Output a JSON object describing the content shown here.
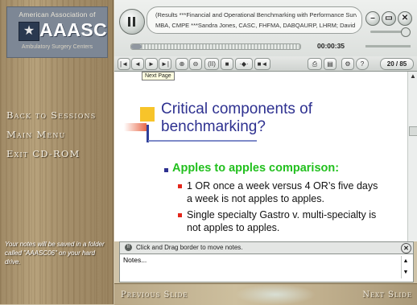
{
  "logo": {
    "top_text": "American Association of",
    "name": "AAASC",
    "sub_text": "Ambulatory Surgery Centers"
  },
  "nav": {
    "back": "Back to Sessions",
    "main_menu": "Main Menu",
    "exit": "Exit CD-ROM"
  },
  "notes_message": "Your notes will be saved in a folder called \"AAASC06\" on your hard drive.",
  "player": {
    "info_line1": "(Results ***Financial and Operational Benchmarking with Performance Survey Res",
    "info_line2": "MBA, CMPE ***Sandra Jones, CASC, FHFMA, DABQAURP, LHRM; David Schlactus,",
    "time": "00:00:35",
    "seek_progress": 0.06,
    "volume_level": 0.85,
    "page_indicator": "20 / 85",
    "tooltip": "Next Page"
  },
  "toolbar": {
    "first": "|◄",
    "prev": "◄",
    "next": "►",
    "last": "►|",
    "zoom_in": "⊕",
    "zoom_out": "⊖",
    "pause_mini": "(II)",
    "stop": "■",
    "vol": "·◆·",
    "mute": "■◄",
    "print": "⎙",
    "settings": "⚙",
    "help": "?"
  },
  "slide": {
    "title": "Critical components of benchmarking?",
    "main_point": "Apples to apples comparison:",
    "points": [
      "1 OR once a week versus 4 OR’s five days a week is not apples to apples.",
      "Single specialty Gastro v. multi-specialty is not apples to apples."
    ]
  },
  "notes": {
    "bar_text": "Click and Drag border to move notes.",
    "value": "Notes..."
  },
  "bottom": {
    "previous": "Previous Slide",
    "next": "Next Slide"
  }
}
